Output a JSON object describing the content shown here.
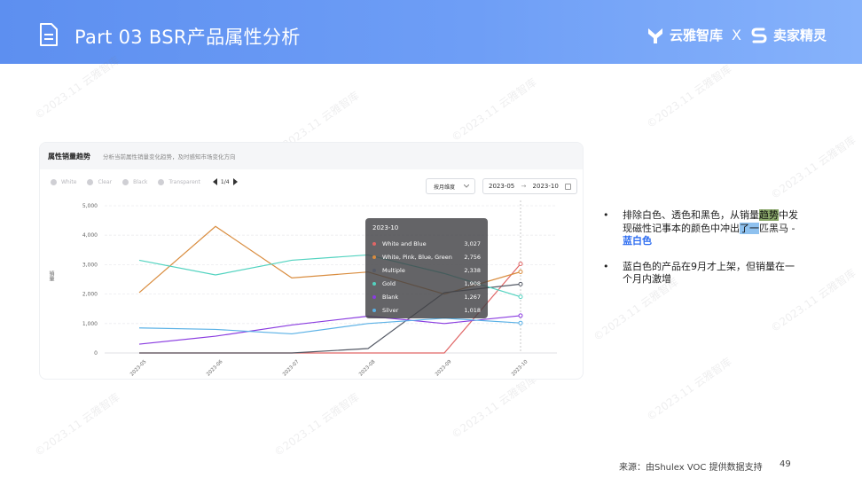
{
  "header": {
    "title": "Part 03  BSR产品属性分析",
    "brand_left": "云雅智库",
    "brand_sep": "X",
    "brand_right": "卖家精灵"
  },
  "watermark_text": "©2023.11 云雅智库",
  "panel": {
    "title": "属性销量趋势",
    "subtitle": "分析当前属性销量变化趋势，及时感知市场变化方向",
    "filters": [
      "White",
      "Clear",
      "Black",
      "Transparent"
    ],
    "pager": "1/4",
    "select": "按月维度",
    "date_from": "2023-05",
    "date_arrow": "→",
    "date_to": "2023-10",
    "ylabel": "销量"
  },
  "tooltip": {
    "title": "2023-10",
    "rows": [
      {
        "name": "White and Blue",
        "value": "3,027"
      },
      {
        "name": "White, Pink, Blue, Green",
        "value": "2,756"
      },
      {
        "name": "Multiple",
        "value": "2,338"
      },
      {
        "name": "Gold",
        "value": "1,908"
      },
      {
        "name": "Blank",
        "value": "1,267"
      },
      {
        "name": "Silver",
        "value": "1,018"
      }
    ]
  },
  "chart_data": {
    "type": "line",
    "x": [
      "2023-05",
      "2023-06",
      "2023-07",
      "2023-08",
      "2023-09",
      "2023-10"
    ],
    "ylim": [
      0,
      5000
    ],
    "yticks": [
      0,
      1000,
      2000,
      3000,
      4000,
      5000
    ],
    "ytick_labels": [
      "0",
      "1,000",
      "2,000",
      "3,000",
      "4,000",
      "5,000"
    ],
    "ylabel": "销量",
    "grid": true,
    "series": [
      {
        "name": "White and Blue",
        "color": "#e06666",
        "values": [
          0,
          0,
          0,
          0,
          0,
          3027
        ]
      },
      {
        "name": "White, Pink, Blue, Green",
        "color": "#d98c3e",
        "values": [
          2050,
          4300,
          2550,
          2750,
          2000,
          2756
        ]
      },
      {
        "name": "Multiple",
        "color": "#555a66",
        "values": [
          0,
          0,
          0,
          150,
          2050,
          2338
        ]
      },
      {
        "name": "Gold",
        "color": "#53d3c0",
        "values": [
          3150,
          2650,
          3150,
          3330,
          2700,
          1908
        ]
      },
      {
        "name": "Blank",
        "color": "#8a3ce0",
        "values": [
          300,
          570,
          950,
          1250,
          1000,
          1267
        ]
      },
      {
        "name": "Silver",
        "color": "#5ab1e6",
        "values": [
          850,
          800,
          650,
          1000,
          1180,
          1018
        ]
      }
    ]
  },
  "bullets": [
    {
      "p1": "排除白色、透色和黑色，从销量",
      "hl1": "趋势",
      "p2": "中发现磁性记事本的颜色中冲出",
      "hl2": "了一",
      "p3": "匹黑马 - ",
      "accent": "蓝白色"
    },
    {
      "text": "蓝白色的产品在9月才上架，但销量在一个月内激增"
    }
  ],
  "footer": {
    "source": "来源：由Shulex VOC 提供数据支持",
    "page": "49"
  }
}
